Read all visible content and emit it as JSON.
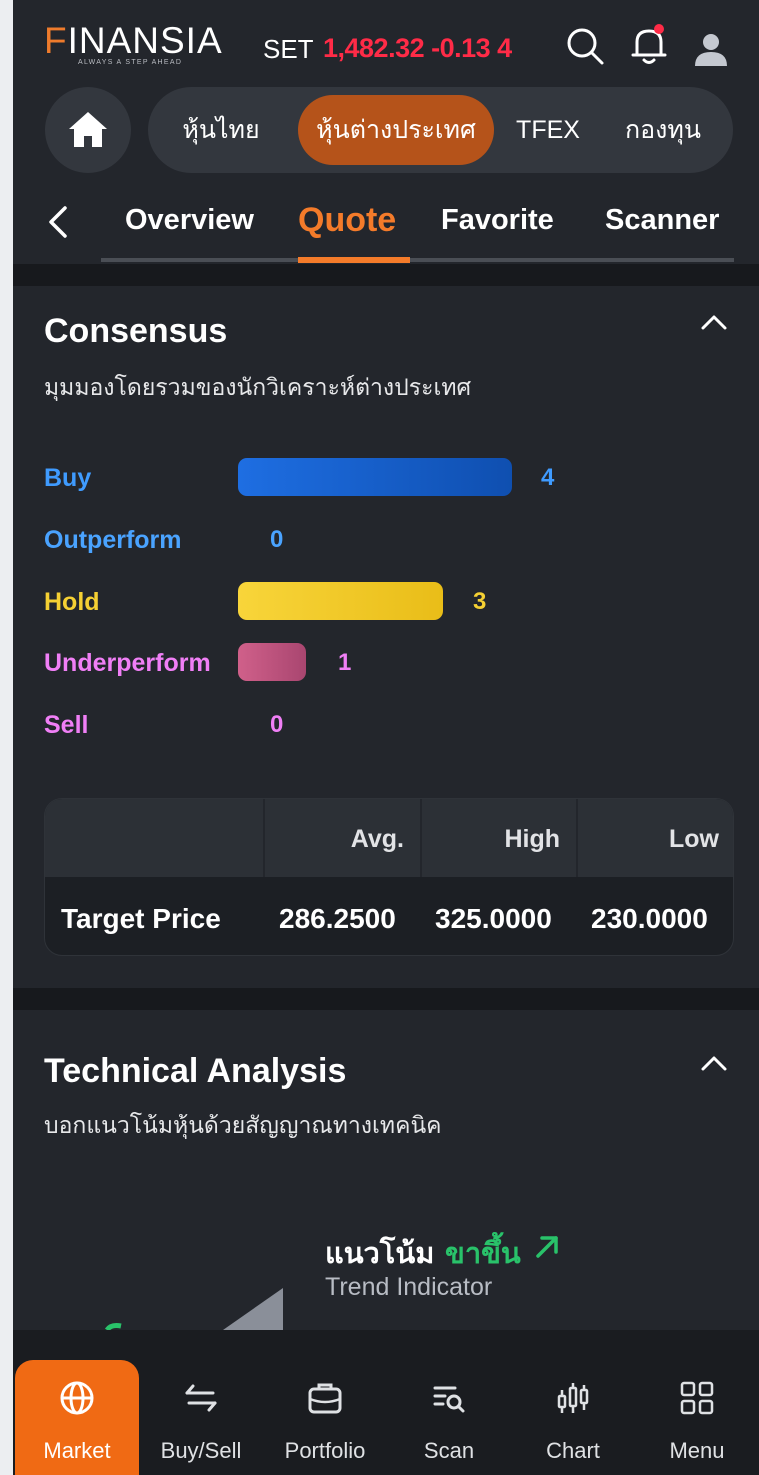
{
  "header": {
    "logo_letter": "F",
    "logo_rest": "INANSIA",
    "logo_tagline": "ALWAYS A STEP AHEAD",
    "set_label": "SET",
    "set_value": "1,482.32 -0.13 4",
    "icons": [
      "search-icon",
      "bell-icon",
      "user-icon"
    ]
  },
  "market_tabs": {
    "home_icon": "home-icon",
    "items": [
      {
        "label": "หุ้นไทย",
        "active": false
      },
      {
        "label": "หุ้นต่างประเทศ",
        "active": true
      },
      {
        "label": "TFEX",
        "active": false
      },
      {
        "label": "กองทุน",
        "active": false
      }
    ]
  },
  "sub_tabs": {
    "back_icon": "chevron-left-icon",
    "items": [
      {
        "label": "Overview",
        "active": false
      },
      {
        "label": "Quote",
        "active": true
      },
      {
        "label": "Favorite",
        "active": false
      },
      {
        "label": "Scanner",
        "active": false
      }
    ]
  },
  "consensus": {
    "title": "Consensus",
    "subtitle": "มุมมองโดยรวมของนักวิเคราะห์ต่างประเทศ",
    "collapse_icon": "chevron-up-icon",
    "ratings": [
      {
        "label": "Buy",
        "count": 4,
        "color": "#3f9bff",
        "bar_color": "#1a63d6"
      },
      {
        "label": "Outperform",
        "count": 0,
        "color": "#4aa3ff",
        "bar_color": "#4aa3ff"
      },
      {
        "label": "Hold",
        "count": 3,
        "color": "#f5d033",
        "bar_color": "#f2cb2b"
      },
      {
        "label": "Underperform",
        "count": 1,
        "color": "#f07ff6",
        "bar_color": "#c2557f"
      },
      {
        "label": "Sell",
        "count": 0,
        "color": "#f07ff6",
        "bar_color": "#f07ff6"
      }
    ],
    "target_table": {
      "headers": [
        "",
        "Avg.",
        "High",
        "Low"
      ],
      "row_label": "Target Price",
      "values": [
        "286.2500",
        "325.0000",
        "230.0000"
      ]
    }
  },
  "technical": {
    "title": "Technical Analysis",
    "subtitle": "บอกแนวโน้มหุ้นด้วยสัญญาณทางเทคนิค",
    "collapse_icon": "chevron-up-icon",
    "trend_label": "แนวโน้ม",
    "trend_value": "ขาขึ้น",
    "trend_icon": "arrow-up-right-icon",
    "trend_sub": "Trend Indicator",
    "trend_color": "#29c26a"
  },
  "bottom_nav": [
    {
      "label": "Market",
      "icon": "globe-icon",
      "active": true
    },
    {
      "label": "Buy/Sell",
      "icon": "swap-icon",
      "active": false
    },
    {
      "label": "Portfolio",
      "icon": "briefcase-icon",
      "active": false
    },
    {
      "label": "Scan",
      "icon": "scan-icon",
      "active": false
    },
    {
      "label": "Chart",
      "icon": "candlestick-icon",
      "active": false
    },
    {
      "label": "Menu",
      "icon": "grid-icon",
      "active": false
    }
  ],
  "colors": {
    "accent": "#f47b2a",
    "background": "#23262c",
    "set_value": "#ff2b47"
  }
}
